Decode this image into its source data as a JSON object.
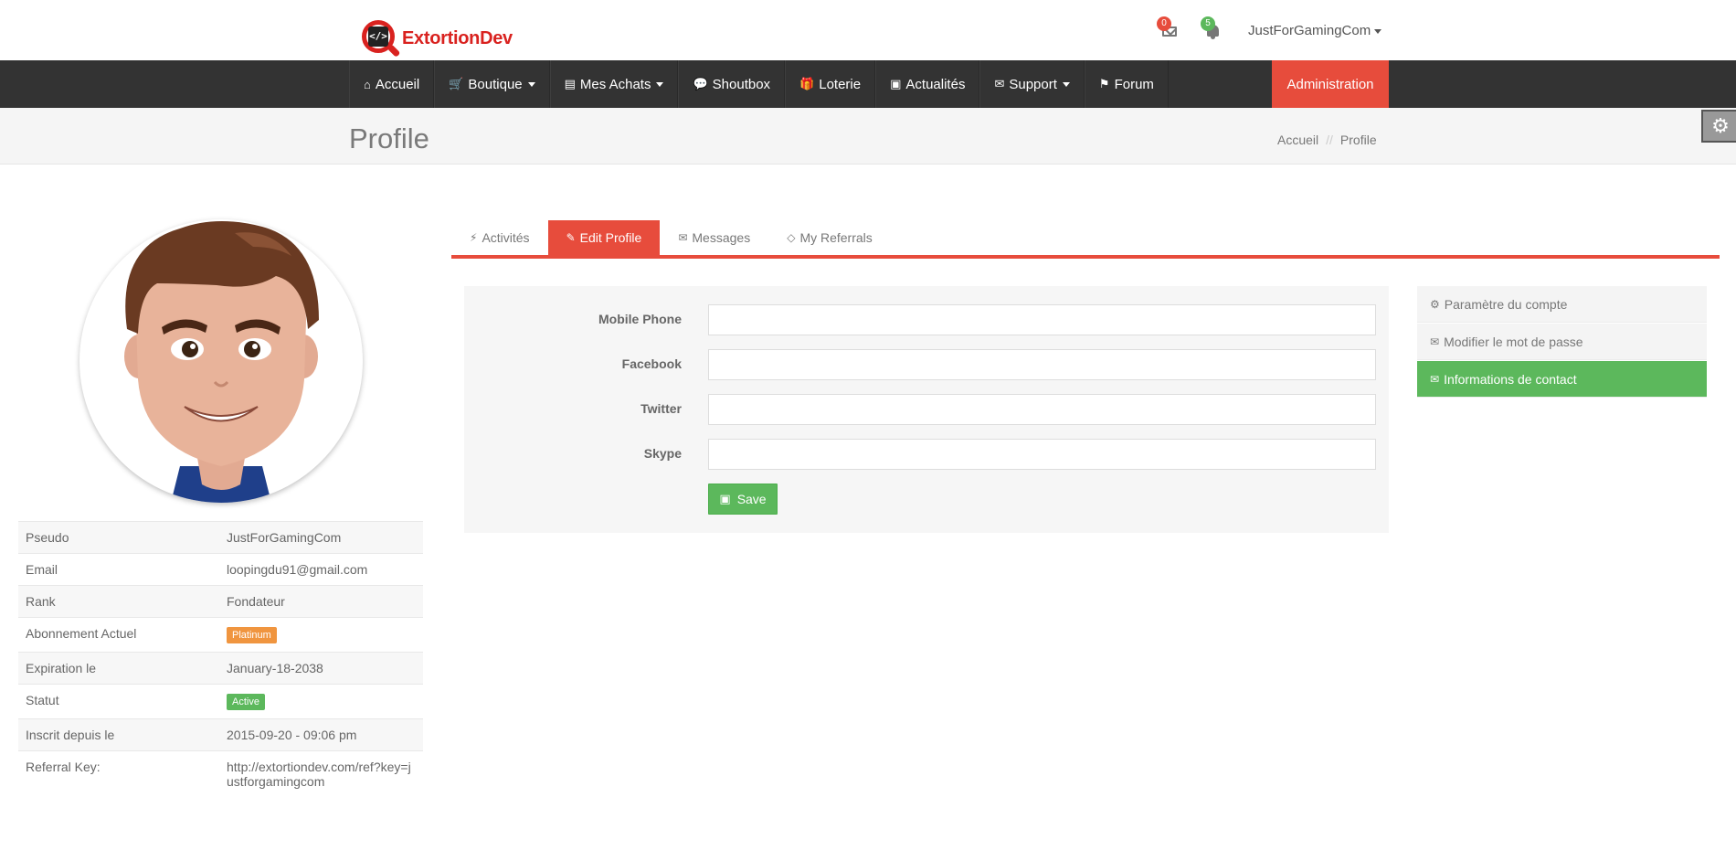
{
  "brand": {
    "name": "ExtortionDev",
    "mark": "</>",
    "color": "#d9221f"
  },
  "header": {
    "messages_count": "0",
    "notifications_count": "5",
    "username": "JustForGamingCom"
  },
  "nav": {
    "items": [
      {
        "label": "Accueil",
        "icon": "home-icon",
        "glyph": "⌂"
      },
      {
        "label": "Boutique",
        "icon": "cart-icon",
        "glyph": "🛒",
        "dropdown": true
      },
      {
        "label": "Mes Achats",
        "icon": "book-icon",
        "glyph": "▤",
        "dropdown": true
      },
      {
        "label": "Shoutbox",
        "icon": "comments-icon",
        "glyph": "💬"
      },
      {
        "label": "Loterie",
        "icon": "gift-icon",
        "glyph": "🎁"
      },
      {
        "label": "Actualités",
        "icon": "image-icon",
        "glyph": "▣"
      },
      {
        "label": "Support",
        "icon": "envelope-icon",
        "glyph": "✉",
        "dropdown": true
      },
      {
        "label": "Forum",
        "icon": "flag-icon",
        "glyph": "⚑"
      }
    ],
    "admin_label": "Administration"
  },
  "page": {
    "title": "Profile",
    "breadcrumb": {
      "home": "Accueil",
      "separator": "//",
      "current": "Profile"
    }
  },
  "profile": {
    "rows": [
      {
        "key": "Pseudo",
        "value": "JustForGamingCom"
      },
      {
        "key": "Email",
        "value": "loopingdu91@gmail.com"
      },
      {
        "key": "Rank",
        "value": "Fondateur"
      },
      {
        "key": "Abonnement Actuel",
        "value": "Platinum",
        "badge_color": "#f0953f"
      },
      {
        "key": "Expiration le",
        "value": "January-18-2038"
      },
      {
        "key": "Statut",
        "value": "Active",
        "badge_color": "#5cb85c"
      },
      {
        "key": "Inscrit depuis le",
        "value": "2015-09-20 - 09:06 pm"
      },
      {
        "key": "Referral Key:",
        "value": "http://extortiondev.com/ref?key=justforgamingcom"
      }
    ]
  },
  "tabs": [
    {
      "label": "Activités",
      "icon": "bolt-icon",
      "glyph": "⚡"
    },
    {
      "label": "Edit Profile",
      "icon": "edit-icon",
      "glyph": "✎",
      "active": true
    },
    {
      "label": "Messages",
      "icon": "envelope-icon",
      "glyph": "✉"
    },
    {
      "label": "My Referrals",
      "icon": "diamond-icon",
      "glyph": "◇"
    }
  ],
  "form": {
    "fields": [
      {
        "label": "Mobile Phone",
        "value": ""
      },
      {
        "label": "Facebook",
        "value": ""
      },
      {
        "label": "Twitter",
        "value": ""
      },
      {
        "label": "Skype",
        "value": ""
      }
    ],
    "save_label": "Save"
  },
  "side_menu": [
    {
      "label": "Paramètre du compte",
      "icon": "cogs-icon",
      "glyph": "⚙"
    },
    {
      "label": "Modifier le mot de passe",
      "icon": "envelope-icon",
      "glyph": "✉"
    },
    {
      "label": "Informations de contact",
      "icon": "envelope-icon",
      "glyph": "✉",
      "active": true
    }
  ],
  "colors": {
    "accent": "#e74c3c",
    "success": "#5cb85c",
    "nav_bg": "#333333"
  }
}
